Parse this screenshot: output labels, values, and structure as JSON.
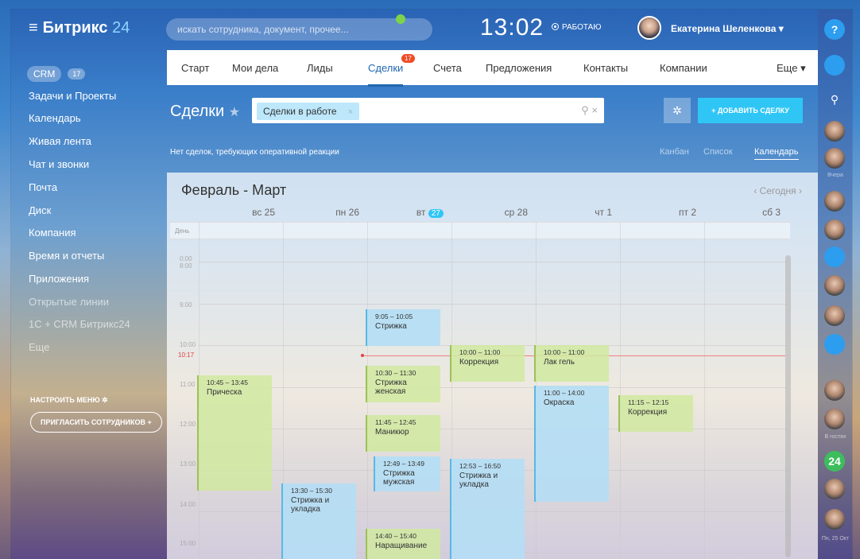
{
  "header": {
    "logo_text": "Битрикс",
    "logo_num": "24",
    "search_placeholder": "искать сотрудника, документ, прочее...",
    "clock": "13:02",
    "status": "РАБОТАЮ",
    "user_name": "Екатерина Шеленкова ▾"
  },
  "sidebar": {
    "crm_label": "CRM",
    "crm_count": "17",
    "items": [
      {
        "label": "Задачи и Проекты"
      },
      {
        "label": "Календарь"
      },
      {
        "label": "Живая лента"
      },
      {
        "label": "Чат и звонки"
      },
      {
        "label": "Почта"
      },
      {
        "label": "Диск"
      },
      {
        "label": "Компания"
      },
      {
        "label": "Время и отчеты"
      },
      {
        "label": "Приложения"
      },
      {
        "label": "Открытые линии"
      },
      {
        "label": "1С + CRM Битрикс24"
      },
      {
        "label": "Еще"
      }
    ],
    "settings_label": "НАСТРОИТЬ МЕНЮ ✲",
    "invite_label": "ПРИГЛАСИТЬ СОТРУДНИКОВ +"
  },
  "tabs": [
    {
      "label": "Старт"
    },
    {
      "label": "Мои дела"
    },
    {
      "label": "Лиды"
    },
    {
      "label": "Сделки",
      "badge": "17"
    },
    {
      "label": "Счета"
    },
    {
      "label": "Предложения"
    },
    {
      "label": "Контакты"
    },
    {
      "label": "Компании"
    },
    {
      "label": "Еще ▾"
    }
  ],
  "page": {
    "title": "Сделки",
    "filter_chip": "Сделки в работе",
    "filter_chip_close": "×",
    "filter_icons": "⚲  ×",
    "add_button": "+ ДОБАВИТЬ СДЕЛКУ",
    "notice": "Нет сделок, требующих оперативной реакции",
    "views": [
      "Канбан",
      "Список",
      "Календарь"
    ]
  },
  "calendar": {
    "title": "Февраль - Март",
    "nav": "‹ Сегодня ›",
    "days": [
      {
        "label": "вс 25"
      },
      {
        "label": "пн 26"
      },
      {
        "label": "вт",
        "today": "27"
      },
      {
        "label": "ср 28"
      },
      {
        "label": "чт 1"
      },
      {
        "label": "пт 2"
      },
      {
        "label": "сб 3"
      }
    ],
    "allday_label": "День",
    "hours": [
      "0:00",
      "8:00",
      "9:00",
      "10:00",
      "10:17",
      "11:00",
      "12:00",
      "13:00",
      "14:00",
      "15:00"
    ],
    "events": [
      {
        "time": "9:05 – 10:05",
        "title": "Стрижка",
        "color": "blue"
      },
      {
        "time": "10:00 – 11:00",
        "title": "Коррекция",
        "color": "green"
      },
      {
        "time": "10:00 – 11:00",
        "title": "Лак гель",
        "color": "green"
      },
      {
        "time": "10:30 – 11:30",
        "title": "Стрижка женская",
        "color": "green"
      },
      {
        "time": "10:45 – 13:45",
        "title": "Прическа",
        "color": "green"
      },
      {
        "time": "11:00 – 14:00",
        "title": "Окраска",
        "color": "blue"
      },
      {
        "time": "11:15 – 12:15",
        "title": "Коррекция",
        "color": "green"
      },
      {
        "time": "11:45 – 12:45",
        "title": "Маникюр",
        "color": "green"
      },
      {
        "time": "12:49 – 13:49",
        "title": "Стрижка мужская",
        "color": "blue"
      },
      {
        "time": "12:53 – 16:50",
        "title": "Стрижка и укладка",
        "color": "blue"
      },
      {
        "time": "13:30 – 15:30",
        "title": "Стрижка и укладка",
        "color": "blue"
      },
      {
        "time": "14:40 – 15:40",
        "title": "Наращивание",
        "color": "green"
      }
    ]
  },
  "right_bar": {
    "help": "?",
    "search": "⚲",
    "yesterday": "Вчера",
    "b24": "24",
    "note1": "В гостях",
    "note2": "Пн, 25 Окт"
  },
  "colors": {
    "accent": "#2fc6f6",
    "tab_active": "#2067b0",
    "badge": "#f04b26"
  }
}
